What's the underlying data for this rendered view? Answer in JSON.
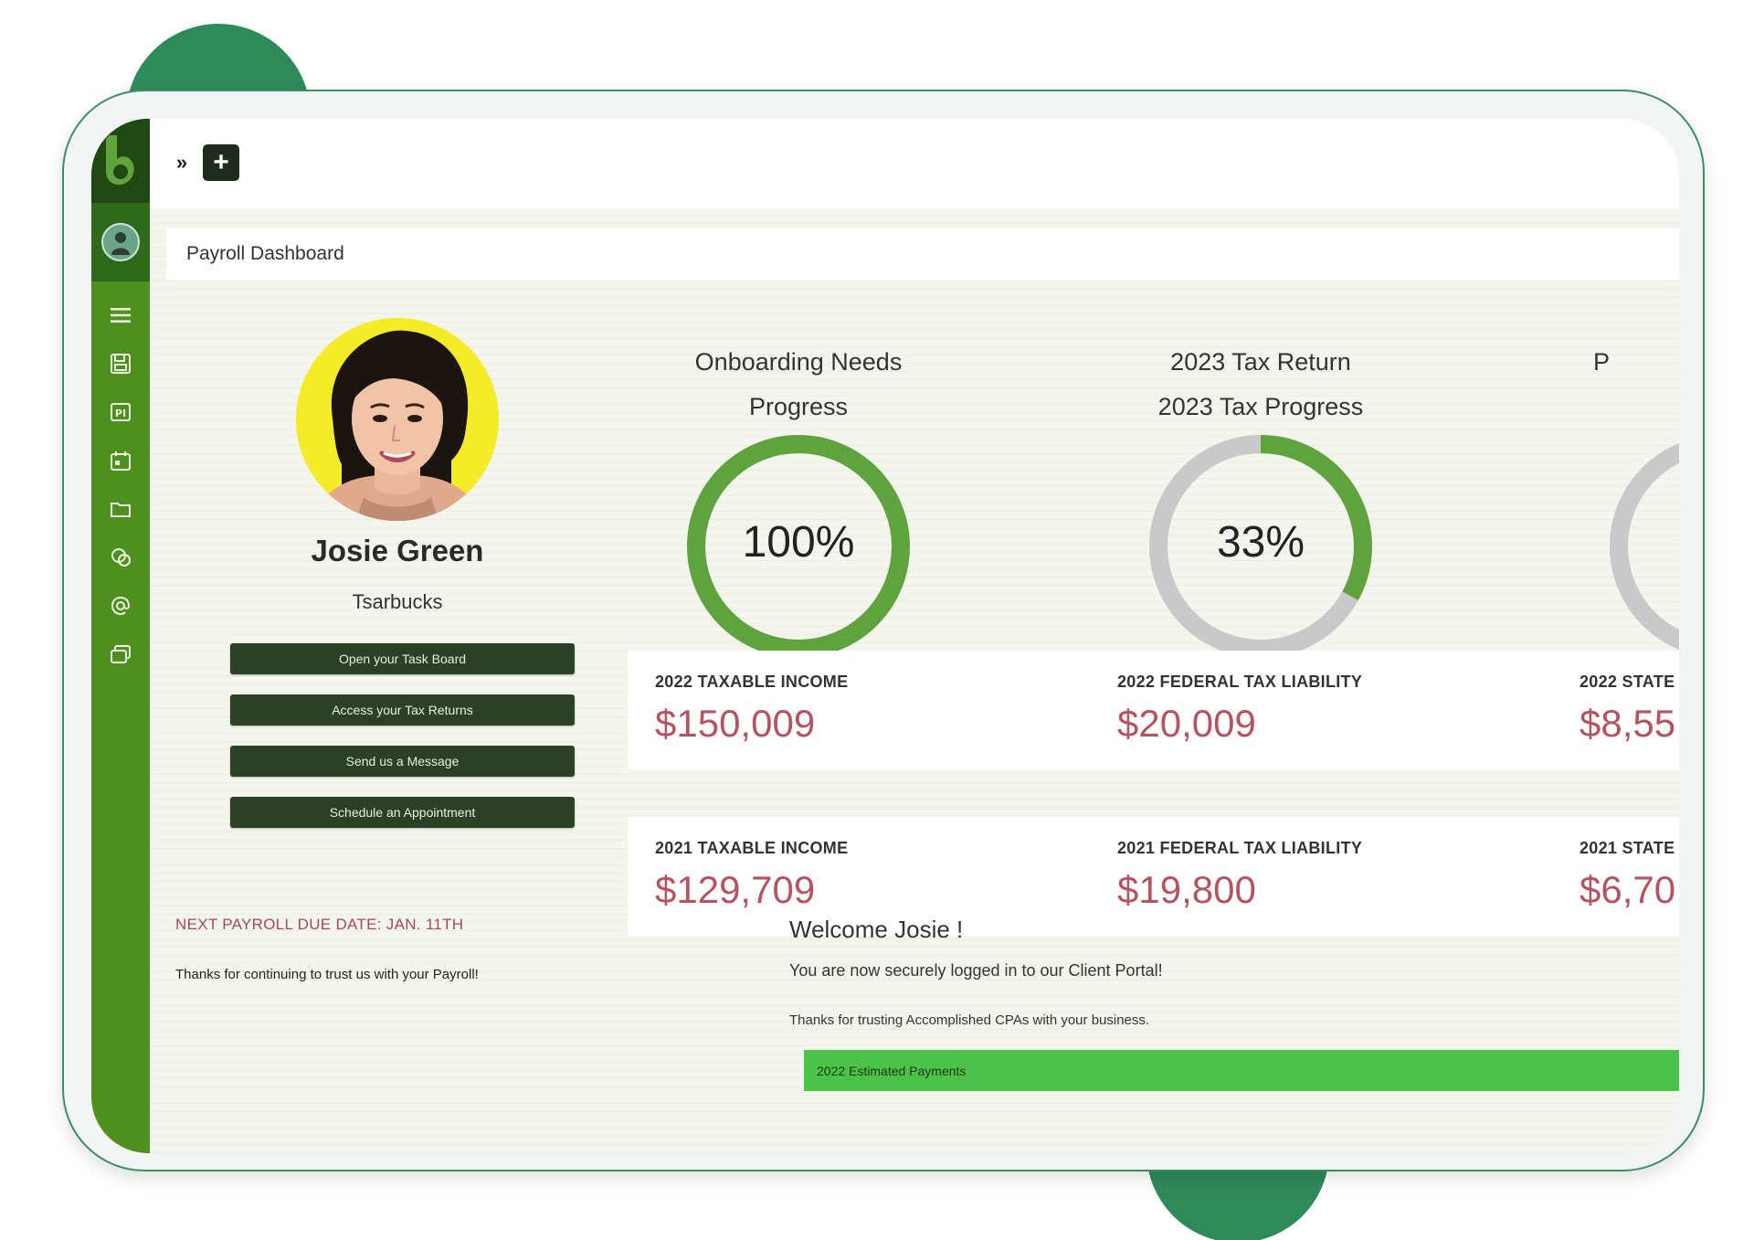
{
  "colors": {
    "sidebar": "#4f8f1f",
    "sidebar_dark": "#1f4812",
    "accent_green": "#5ea33d",
    "ring_track": "#c9c9c9",
    "value_red": "#b55461",
    "button_dark": "#2c3f27",
    "estimated_bar": "#4cc24a"
  },
  "sidebar": {
    "icons": [
      "menu-icon",
      "save-icon",
      "pi-card-icon",
      "calendar-icon",
      "folder-icon",
      "support-chat-icon",
      "at-sign-icon",
      "windows-icon"
    ]
  },
  "topbar": {
    "expand_glyph": "»",
    "add_glyph": "+"
  },
  "page": {
    "title": "Payroll Dashboard"
  },
  "profile": {
    "name": "Josie Green",
    "company": "Tsarbucks",
    "buttons": [
      "Open your Task Board",
      "Access your Tax Returns",
      "Send us a Message",
      "Schedule an Appointment"
    ]
  },
  "payroll": {
    "due": "NEXT PAYROLL DUE DATE: JAN. 11TH",
    "thanks": "Thanks for continuing to trust us with your Payroll!"
  },
  "gauges": [
    {
      "title_line1": "Onboarding Needs",
      "title_line2": "Progress",
      "label": "100%",
      "percent": 100
    },
    {
      "title_line1": "2023 Tax Return",
      "title_line2": "2023 Tax Progress",
      "label": "33%",
      "percent": 33
    },
    {
      "title_line1": "",
      "title_line2": "P",
      "label": "",
      "percent": 50
    }
  ],
  "stats": {
    "row2022": [
      {
        "label": "2022 TAXABLE INCOME",
        "value": "$150,009"
      },
      {
        "label": "2022 FEDERAL TAX LIABILITY",
        "value": "$20,009"
      },
      {
        "label": "2022 STATE",
        "value": "$8,55"
      }
    ],
    "row2021": [
      {
        "label": "2021 TAXABLE INCOME",
        "value": "$129,709"
      },
      {
        "label": "2021 FEDERAL TAX LIABILITY",
        "value": "$19,800"
      },
      {
        "label": "2021 STATE",
        "value": "$6,70"
      }
    ]
  },
  "welcome": {
    "title": "Welcome Josie !",
    "line1": "You are now securely logged in to our Client Portal!",
    "line2": "Thanks for trusting Accomplished CPAs with your business."
  },
  "estimated_payments": {
    "label": "2022 Estimated Payments"
  }
}
